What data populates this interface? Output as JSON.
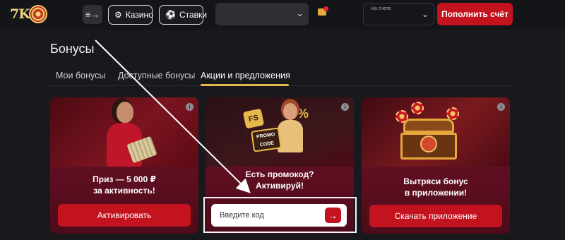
{
  "header": {
    "logo_text": "7K",
    "menu_icon": "menu-arrow-icon",
    "nav": [
      {
        "label": "Казино",
        "icon": "casino-chip-icon"
      },
      {
        "label": "Ставки",
        "icon": "soccer-ball-icon"
      }
    ],
    "balance_chevron": "chevron-down-icon",
    "mail_icon": "mail-icon",
    "account_label": "На счете",
    "deposit_label": "Пополнить счёт"
  },
  "page": {
    "title": "Бонусы",
    "tabs": [
      {
        "label": "Мои бонусы",
        "active": false
      },
      {
        "label": "Доступные бонусы",
        "active": false
      },
      {
        "label": "Акции и предложения",
        "active": true
      }
    ]
  },
  "cards": [
    {
      "text_line1": "Приз — 5 000 ₽",
      "text_line2": "за активность!",
      "button_label": "Активировать"
    },
    {
      "text_line1": "Есть промокод?",
      "text_line2": "Активируй!",
      "badge_fs": "FS",
      "badge_pct": "%",
      "promo_line1": "PROMO",
      "promo_line2": "CODE",
      "input_placeholder": "Введите код"
    },
    {
      "text_line1": "Вытряси бонус",
      "text_line2": "в приложении!",
      "button_label": "Скачать приложение"
    }
  ],
  "colors": {
    "accent_red": "#c2131f",
    "tab_underline": "#e9b54f",
    "background": "#18191d",
    "card_body": "#4d0b1a"
  }
}
